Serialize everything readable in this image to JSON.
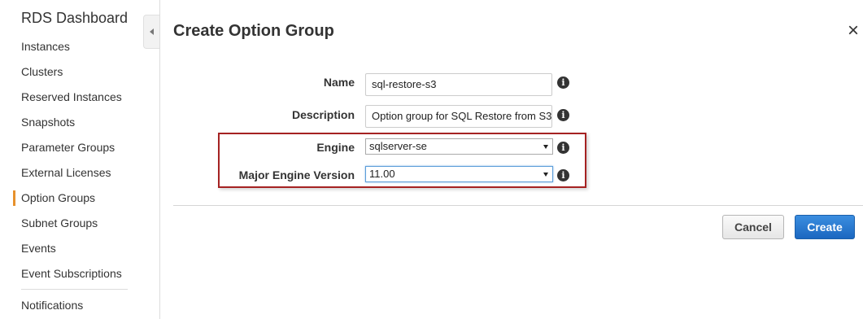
{
  "sidebar": {
    "title": "RDS Dashboard",
    "items": [
      {
        "label": "Instances"
      },
      {
        "label": "Clusters"
      },
      {
        "label": "Reserved Instances"
      },
      {
        "label": "Snapshots"
      },
      {
        "label": "Parameter Groups"
      },
      {
        "label": "External Licenses"
      },
      {
        "label": "Option Groups",
        "active": true
      },
      {
        "label": "Subnet Groups"
      },
      {
        "label": "Events"
      },
      {
        "label": "Event Subscriptions"
      },
      {
        "label": "Notifications"
      }
    ],
    "active_color": "#e7912c"
  },
  "dialog": {
    "title": "Create Option Group",
    "close_glyph": "×",
    "form": {
      "name_label": "Name",
      "name_value": "sql-restore-s3",
      "description_label": "Description",
      "description_value": "Option group for SQL Restore from S3",
      "engine_label": "Engine",
      "engine_value": "sqlserver-se",
      "version_label": "Major Engine Version",
      "version_value": "11.00",
      "info_glyph": "i"
    },
    "buttons": {
      "cancel": "Cancel",
      "create": "Create"
    },
    "highlight_color": "#a52222",
    "primary_color": "#1b67c0"
  }
}
